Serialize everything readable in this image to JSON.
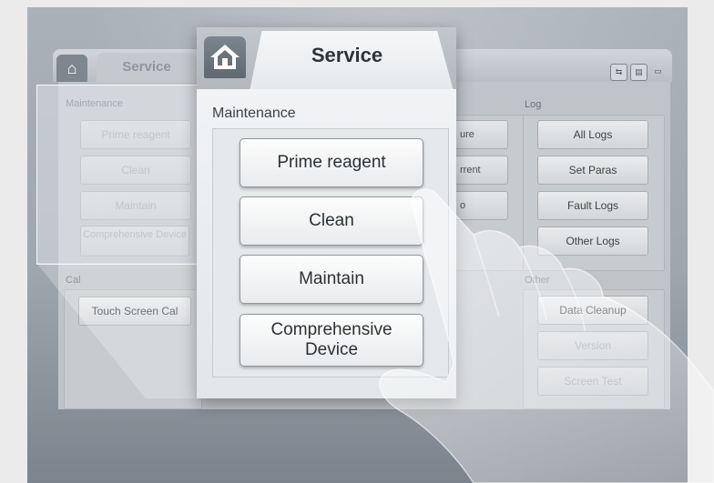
{
  "background_ui": {
    "service_tab": "Service",
    "sections": {
      "maintenance": {
        "label": "Maintenance",
        "buttons": [
          "Prime reagent",
          "Clean",
          "Maintain",
          "Comprehensive Device"
        ]
      },
      "calibration": {
        "label": "Cal",
        "buttons": [
          "Touch Screen Cal"
        ]
      },
      "middle": {
        "partial_buttons": [
          "ure",
          "rrent",
          "o"
        ]
      },
      "log": {
        "label": "Log",
        "buttons": [
          "All Logs",
          "Set Paras",
          "Fault Logs",
          "Other Logs"
        ]
      },
      "other": {
        "label": "Other",
        "buttons": [
          "Data Cleanup",
          "Version",
          "Screen Test"
        ]
      }
    },
    "header_icons": [
      "usb-icon",
      "printer-icon",
      "monitor-icon"
    ]
  },
  "popup": {
    "tab_title": "Service",
    "home_icon": "home-icon",
    "section_label": "Maintenance",
    "buttons": {
      "prime": "Prime reagent",
      "clean": "Clean",
      "maintain": "Maintain",
      "comprehensive_line1": "Comprehensive",
      "comprehensive_line2": "Device"
    }
  },
  "colors": {
    "screen": "#a3aab2",
    "accent_tab": "#6c747c",
    "button_text": "#2c3136"
  }
}
